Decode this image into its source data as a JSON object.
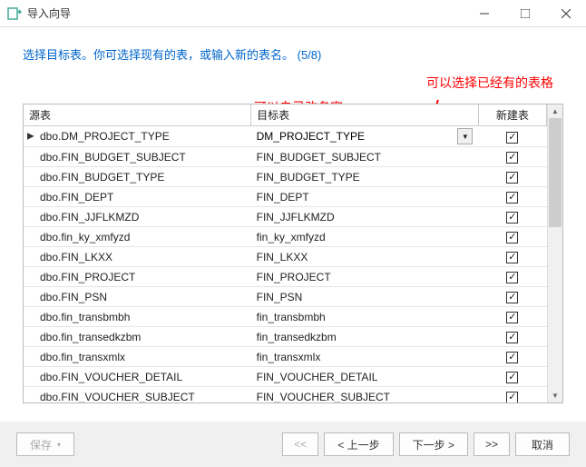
{
  "window": {
    "title": "导入向导"
  },
  "heading": "选择目标表。你可选择现有的表，或输入新的表名。 (5/8)",
  "annotations": {
    "rename": "可以自己改名字",
    "pick_existing": "可以选择已经有的表格"
  },
  "columns": {
    "source": "源表",
    "target": "目标表",
    "newtable": "新建表"
  },
  "rows": [
    {
      "src": "dbo.DM_PROJECT_TYPE",
      "dst": "DM_PROJECT_TYPE",
      "new": true,
      "active": true
    },
    {
      "src": "dbo.FIN_BUDGET_SUBJECT",
      "dst": "FIN_BUDGET_SUBJECT",
      "new": true
    },
    {
      "src": "dbo.FIN_BUDGET_TYPE",
      "dst": "FIN_BUDGET_TYPE",
      "new": true
    },
    {
      "src": "dbo.FIN_DEPT",
      "dst": "FIN_DEPT",
      "new": true
    },
    {
      "src": "dbo.FIN_JJFLKMZD",
      "dst": "FIN_JJFLKMZD",
      "new": true
    },
    {
      "src": "dbo.fin_ky_xmfyzd",
      "dst": "fin_ky_xmfyzd",
      "new": true
    },
    {
      "src": "dbo.FIN_LKXX",
      "dst": "FIN_LKXX",
      "new": true
    },
    {
      "src": "dbo.FIN_PROJECT",
      "dst": "FIN_PROJECT",
      "new": true
    },
    {
      "src": "dbo.FIN_PSN",
      "dst": "FIN_PSN",
      "new": true
    },
    {
      "src": "dbo.fin_transbmbh",
      "dst": "fin_transbmbh",
      "new": true
    },
    {
      "src": "dbo.fin_transedkzbm",
      "dst": "fin_transedkzbm",
      "new": true
    },
    {
      "src": "dbo.fin_transxmlx",
      "dst": "fin_transxmlx",
      "new": true
    },
    {
      "src": "dbo.FIN_VOUCHER_DETAIL",
      "dst": "FIN_VOUCHER_DETAIL",
      "new": true
    },
    {
      "src": "dbo.FIN_VOUCHER_SUBJECT",
      "dst": "FIN_VOUCHER_SUBJECT",
      "new": true
    }
  ],
  "buttons": {
    "save": "保存",
    "first": "<<",
    "prev": "< 上一步",
    "next": "下一步 >",
    "last": ">>",
    "cancel": "取消"
  }
}
